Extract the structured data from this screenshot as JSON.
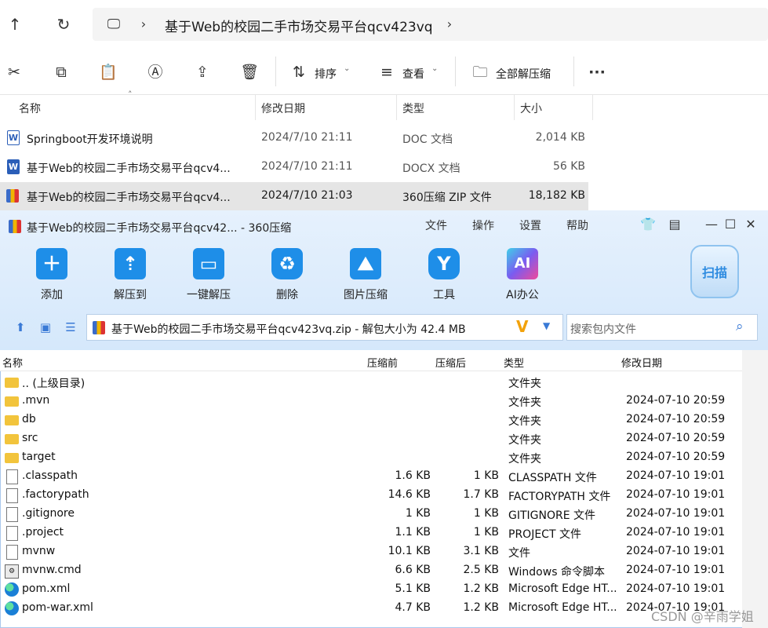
{
  "explorer": {
    "breadcrumb": "基于Web的校园二手市场交易平台qcv423vq",
    "toolbar": {
      "sort_label": "排序",
      "view_label": "查看",
      "extract_all_label": "全部解压缩"
    },
    "columns": [
      "名称",
      "修改日期",
      "类型",
      "大小"
    ],
    "files": [
      {
        "name": "Springboot开发环境说明",
        "date": "2024/7/10 21:11",
        "type": "DOC 文档",
        "size": "2,014 KB",
        "icon": "doc-icon"
      },
      {
        "name": "基于Web的校园二手市场交易平台qcv4...",
        "date": "2024/7/10 21:11",
        "type": "DOCX 文档",
        "size": "56 KB",
        "icon": "docx-icon"
      },
      {
        "name": "基于Web的校园二手市场交易平台qcv4...",
        "date": "2024/7/10 21:03",
        "type": "360压缩 ZIP 文件",
        "size": "18,182 KB",
        "icon": "zip-icon",
        "selected": true
      }
    ]
  },
  "zip_window": {
    "title": "基于Web的校园二手市场交易平台qcv42... - 360压缩",
    "menu": [
      "文件",
      "操作",
      "设置",
      "帮助"
    ],
    "tools": [
      {
        "label": "添加",
        "icon": "add-icon"
      },
      {
        "label": "解压到",
        "icon": "extract-to-icon"
      },
      {
        "label": "一键解压",
        "icon": "one-click-extract-icon"
      },
      {
        "label": "删除",
        "icon": "delete-icon"
      },
      {
        "label": "图片压缩",
        "icon": "image-compress-icon"
      },
      {
        "label": "工具",
        "icon": "tools-icon"
      },
      {
        "label": "AI办公",
        "icon": "ai-office-icon"
      }
    ],
    "scan_label": "扫描",
    "path": "基于Web的校园二手市场交易平台qcv423vq.zip - 解包大小为 42.4 MB",
    "search_placeholder": "搜索包内文件",
    "columns": [
      "名称",
      "压缩前",
      "压缩后",
      "类型",
      "修改日期"
    ],
    "entries": [
      {
        "name": ".. (上级目录)",
        "before": "",
        "after": "",
        "type": "文件夹",
        "date": "",
        "icon": "folder"
      },
      {
        "name": ".mvn",
        "before": "",
        "after": "",
        "type": "文件夹",
        "date": "2024-07-10 20:59",
        "icon": "folder"
      },
      {
        "name": "db",
        "before": "",
        "after": "",
        "type": "文件夹",
        "date": "2024-07-10 20:59",
        "icon": "folder"
      },
      {
        "name": "src",
        "before": "",
        "after": "",
        "type": "文件夹",
        "date": "2024-07-10 20:59",
        "icon": "folder"
      },
      {
        "name": "target",
        "before": "",
        "after": "",
        "type": "文件夹",
        "date": "2024-07-10 20:59",
        "icon": "folder"
      },
      {
        "name": ".classpath",
        "before": "1.6 KB",
        "after": "1 KB",
        "type": "CLASSPATH 文件",
        "date": "2024-07-10 19:01",
        "icon": "file"
      },
      {
        "name": ".factorypath",
        "before": "14.6 KB",
        "after": "1.7 KB",
        "type": "FACTORYPATH 文件",
        "date": "2024-07-10 19:01",
        "icon": "file"
      },
      {
        "name": ".gitignore",
        "before": "1 KB",
        "after": "1 KB",
        "type": "GITIGNORE 文件",
        "date": "2024-07-10 19:01",
        "icon": "file"
      },
      {
        "name": ".project",
        "before": "1.1 KB",
        "after": "1 KB",
        "type": "PROJECT 文件",
        "date": "2024-07-10 19:01",
        "icon": "file"
      },
      {
        "name": "mvnw",
        "before": "10.1 KB",
        "after": "3.1 KB",
        "type": "文件",
        "date": "2024-07-10 19:01",
        "icon": "file"
      },
      {
        "name": "mvnw.cmd",
        "before": "6.6 KB",
        "after": "2.5 KB",
        "type": "Windows 命令脚本",
        "date": "2024-07-10 19:01",
        "icon": "cmd"
      },
      {
        "name": "pom.xml",
        "before": "5.1 KB",
        "after": "1.2 KB",
        "type": "Microsoft Edge HT...",
        "date": "2024-07-10 19:01",
        "icon": "edge"
      },
      {
        "name": "pom-war.xml",
        "before": "4.7 KB",
        "after": "1.2 KB",
        "type": "Microsoft Edge HT...",
        "date": "2024-07-10 19:01",
        "icon": "edge"
      }
    ]
  },
  "watermark": "CSDN @辛雨学姐"
}
